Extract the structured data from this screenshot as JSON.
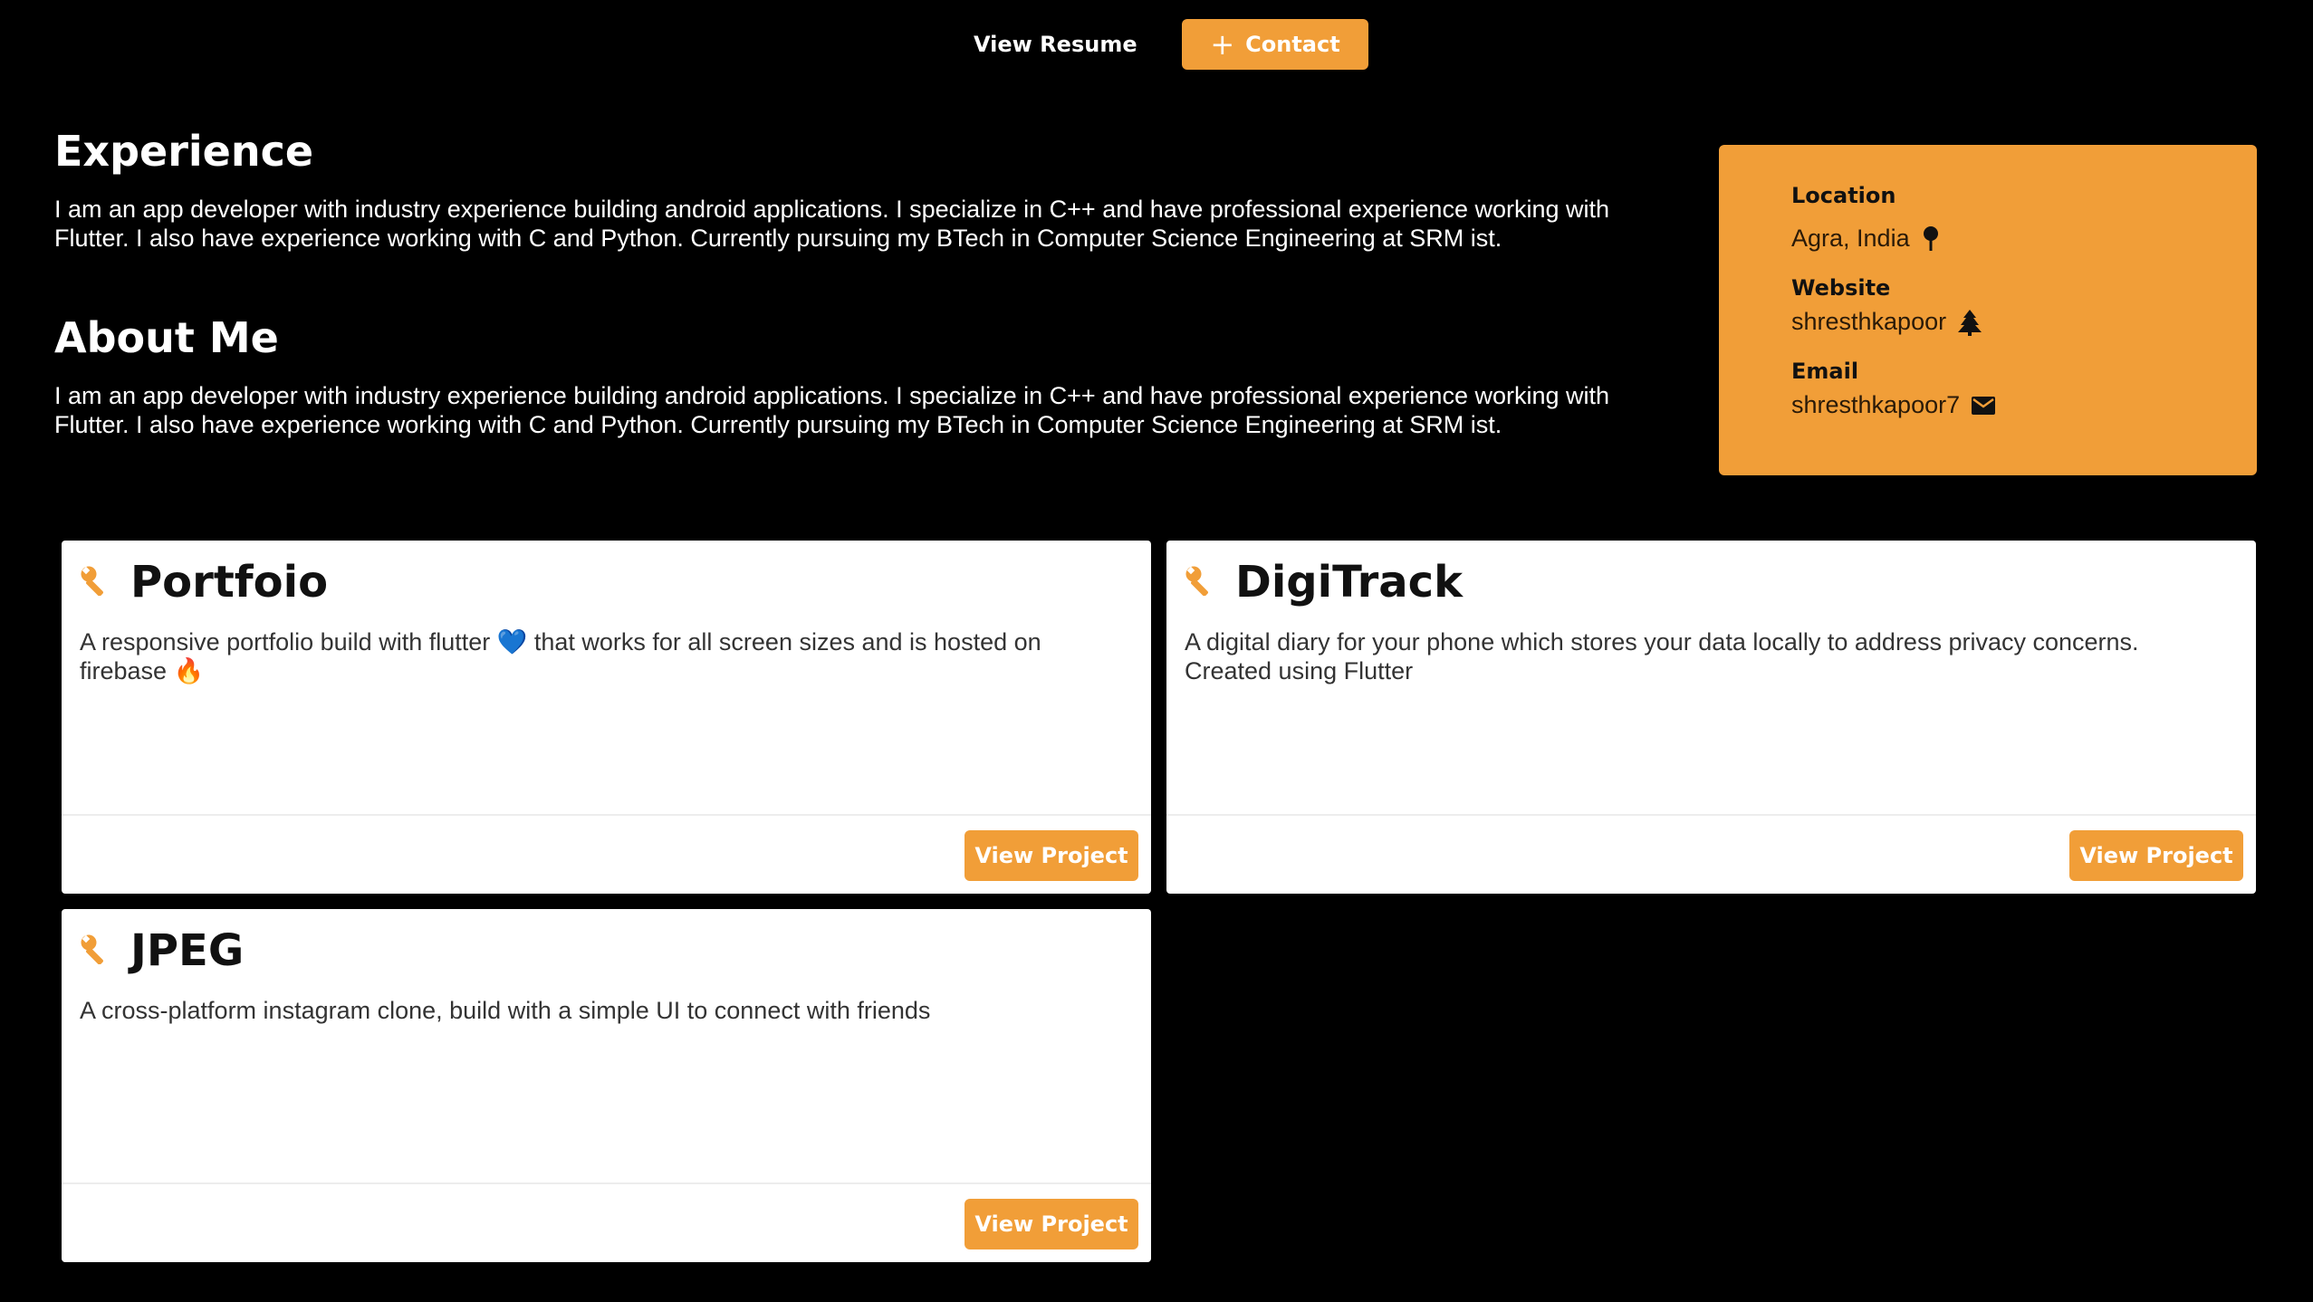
{
  "nav": {
    "resume_label": "View Resume",
    "contact_label": "Contact",
    "contact_icon": "plus-icon"
  },
  "experience": {
    "title": "Experience",
    "text": "I am an app developer with industry experience building android applications. I specialize in C++ and have professional experience working with Flutter. I also have experience working with C and Python. Currently pursuing my BTech in Computer Science Engineering at SRM ist."
  },
  "about": {
    "title": "About Me",
    "text": "I am an app developer with industry experience building android applications. I specialize in C++ and have professional experience working with Flutter. I also have experience working with C and Python. Currently pursuing my BTech in Computer Science Engineering at SRM ist."
  },
  "info": {
    "location_label": "Location",
    "location_value": "Agra, India",
    "location_icon": "pin-icon",
    "website_label": "Website",
    "website_value": "shresthkapoor",
    "website_icon": "tree-icon",
    "email_label": "Email",
    "email_value": "shresthkapoor7",
    "email_icon": "mail-icon"
  },
  "projects": [
    {
      "title": "Portfoio",
      "desc": "A responsive portfolio build with flutter 💙 that works for all screen sizes and is hosted on firebase 🔥",
      "button": "View Project",
      "icon": "wrench-icon"
    },
    {
      "title": "DigiTrack",
      "desc": "A digital diary for your phone which stores your data locally to address privacy concerns. Created using Flutter",
      "button": "View Project",
      "icon": "wrench-icon"
    },
    {
      "title": "JPEG",
      "desc": "A cross-platform instagram clone, build with a simple UI to connect with friends",
      "button": "View Project",
      "icon": "wrench-icon"
    }
  ],
  "colors": {
    "accent": "#f19e38",
    "background": "#000000",
    "card": "#ffffff"
  }
}
